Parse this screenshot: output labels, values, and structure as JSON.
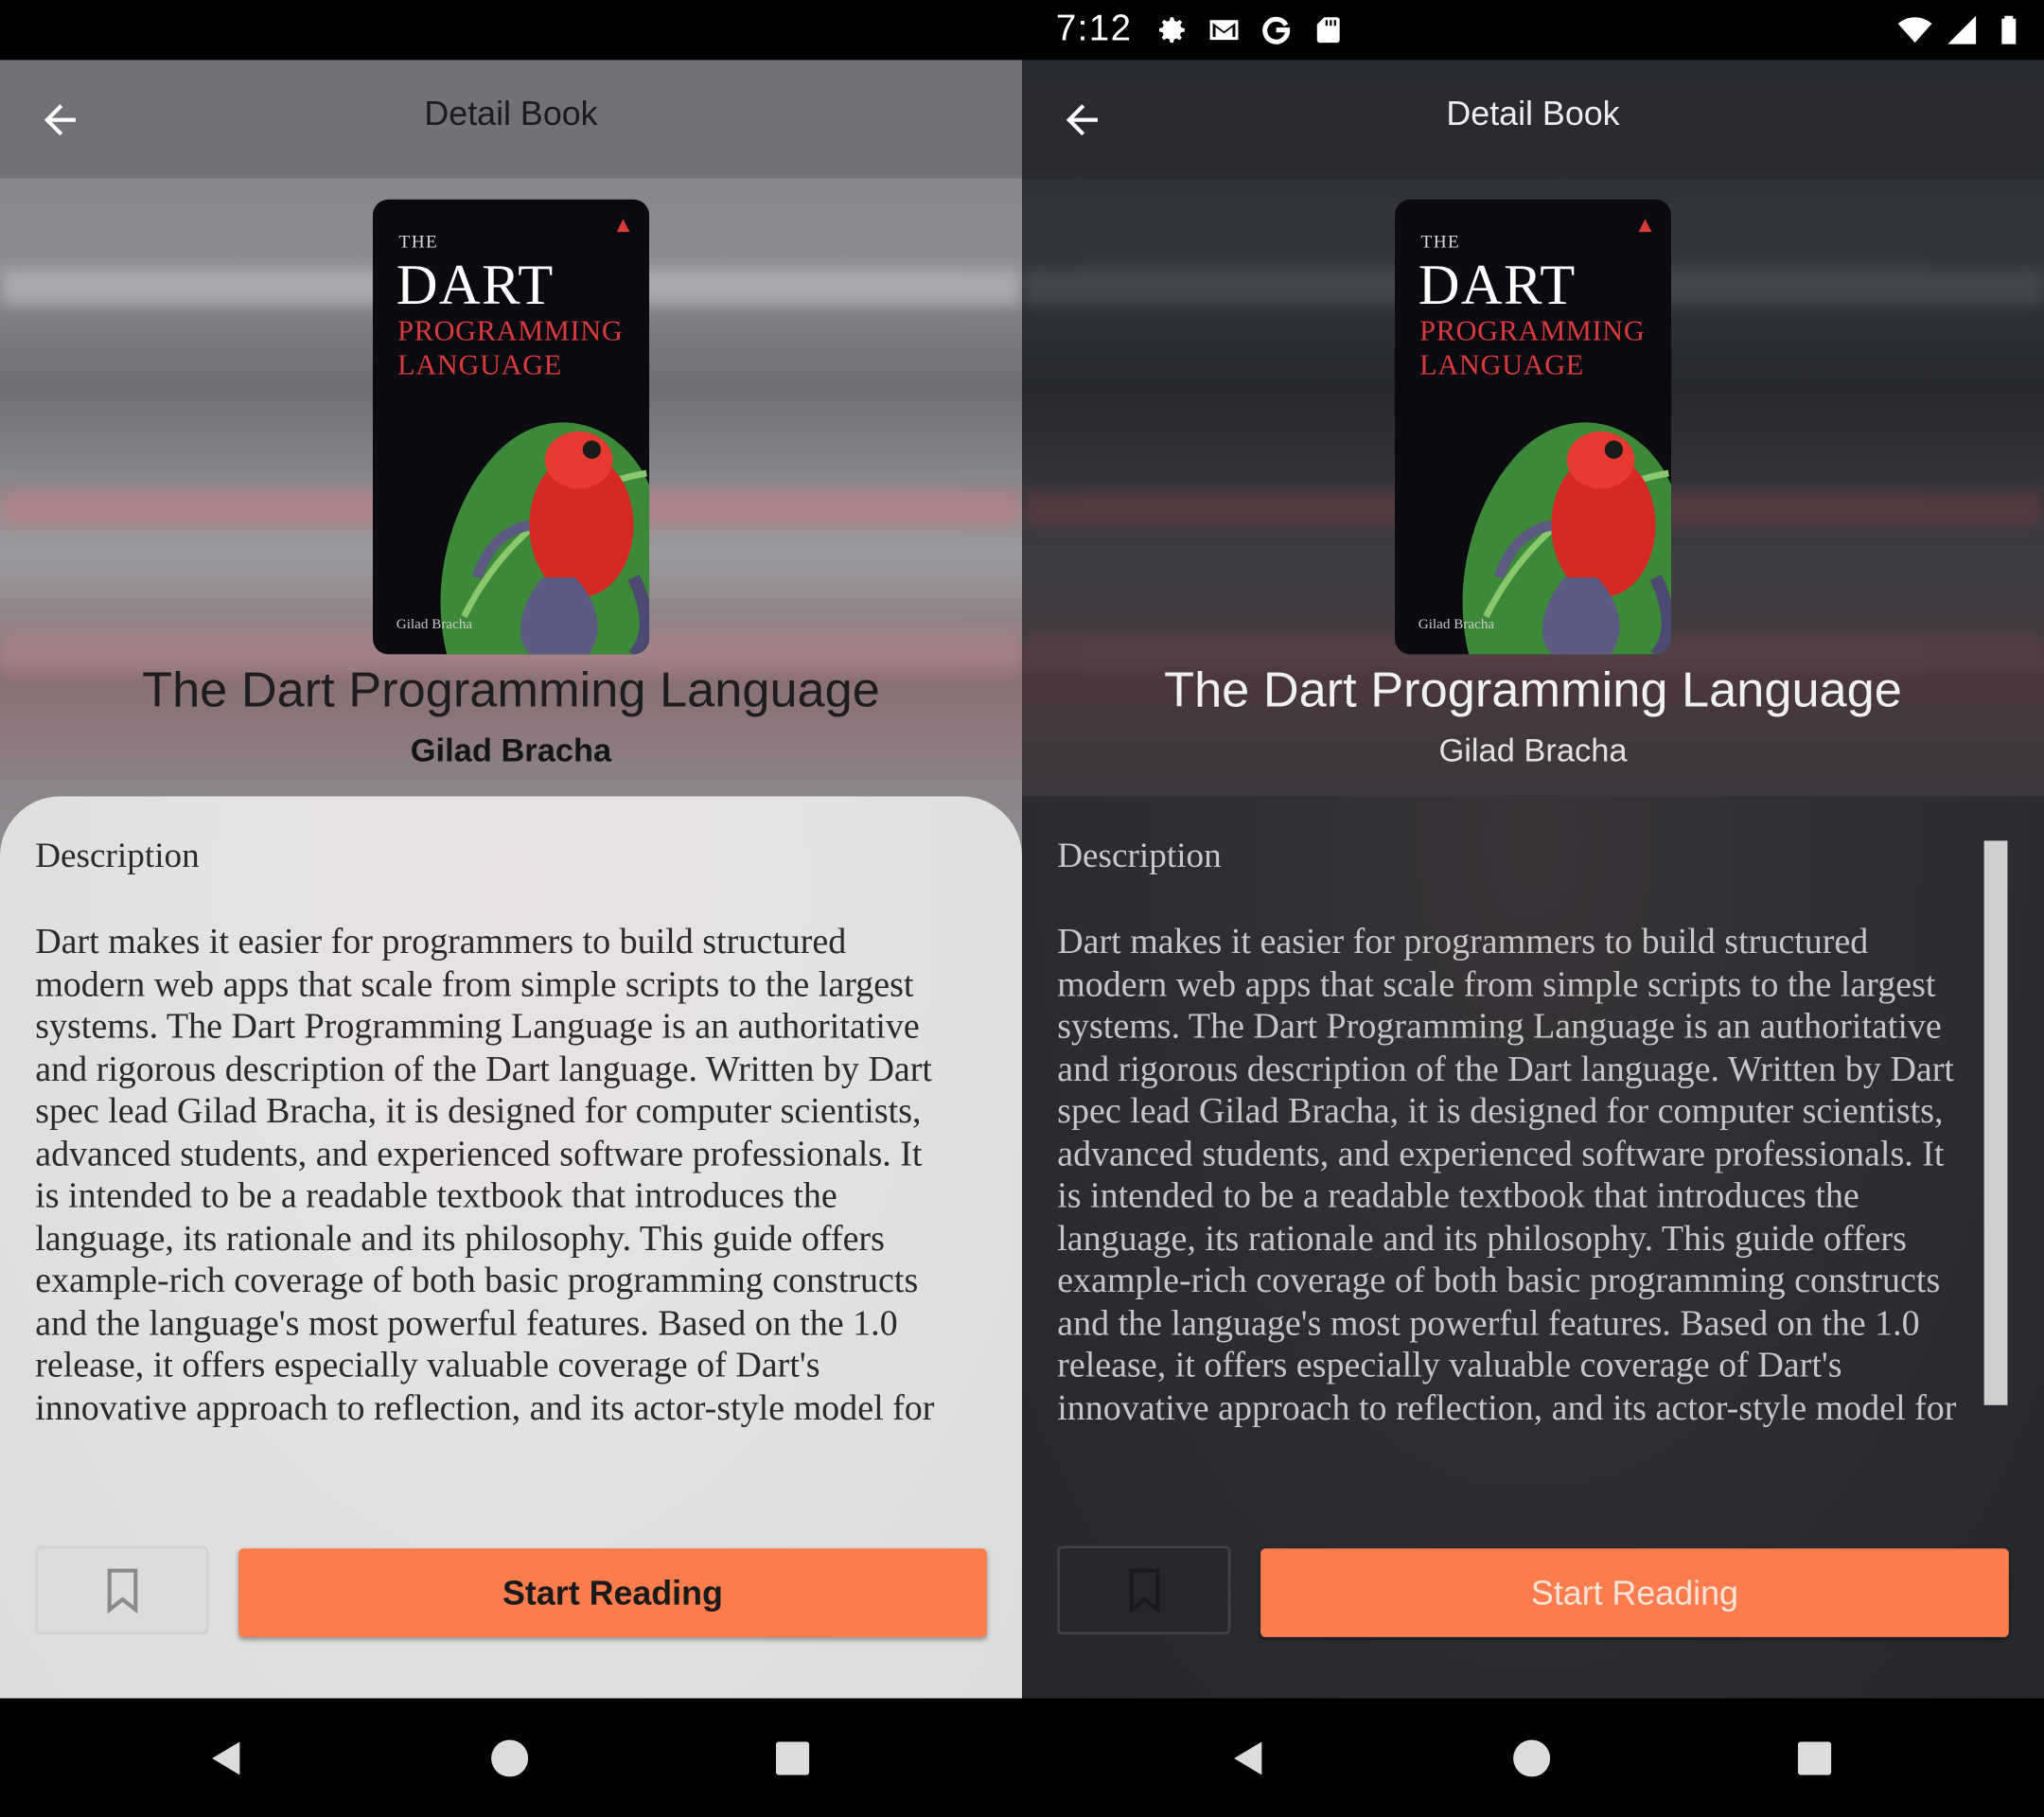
{
  "status_bar": {
    "time": "7:12",
    "left_icons": [
      "settings-icon",
      "gmail-icon",
      "google-icon",
      "sd-card-icon"
    ],
    "right_icons": [
      "wifi-icon",
      "signal-icon",
      "battery-icon"
    ]
  },
  "screens": [
    {
      "theme": "light",
      "appbar": {
        "title": "Detail Book"
      },
      "book": {
        "cover": {
          "the": "THE",
          "dart": "DART",
          "programming": "PROGRAMMING",
          "language": "LANGUAGE",
          "author": "Gilad Bracha"
        },
        "title": "The Dart Programming Language",
        "author": "Gilad Bracha"
      },
      "description": {
        "heading": "Description",
        "text": "Dart makes it easier for programmers to build structured modern web apps that scale from simple scripts to the largest systems. The Dart Programming Language is an authoritative and rigorous description of the Dart language. Written by Dart spec lead Gilad Bracha, it is designed for computer scientists, advanced students, and experienced software professionals. It is intended to be a readable textbook that introduces the language, its rationale and its philosophy. This guide offers example-rich coverage of both basic programming constructs and the language's most powerful features. Based on the 1.0 release, it offers especially valuable coverage of Dart's innovative approach to reflection, and its actor-style model for"
      },
      "actions": {
        "start_reading": "Start Reading"
      }
    },
    {
      "theme": "dark",
      "appbar": {
        "title": "Detail Book"
      },
      "book": {
        "cover": {
          "the": "THE",
          "dart": "DART",
          "programming": "PROGRAMMING",
          "language": "LANGUAGE",
          "author": "Gilad Bracha"
        },
        "title": "The Dart Programming Language",
        "author": "Gilad Bracha"
      },
      "description": {
        "heading": "Description",
        "text": "Dart makes it easier for programmers to build structured modern web apps that scale from simple scripts to the largest systems. The Dart Programming Language is an authoritative and rigorous description of the Dart language. Written by Dart spec lead Gilad Bracha, it is designed for computer scientists, advanced students, and experienced software professionals. It is intended to be a readable textbook that introduces the language, its rationale and its philosophy. This guide offers example-rich coverage of both basic programming constructs and the language's most powerful features. Based on the 1.0 release, it offers especially valuable coverage of Dart's innovative approach to reflection, and its actor-style model for"
      },
      "actions": {
        "start_reading": "Start Reading"
      }
    }
  ],
  "colors": {
    "accent": "#fb7c4c",
    "light_sheet": "#e3e2e3",
    "dark_sheet": "#2b2c31",
    "scrollbar": "#cfcfcf"
  },
  "nav_bar": {
    "icons": [
      "back-triangle-icon",
      "home-circle-icon",
      "recents-square-icon"
    ]
  }
}
